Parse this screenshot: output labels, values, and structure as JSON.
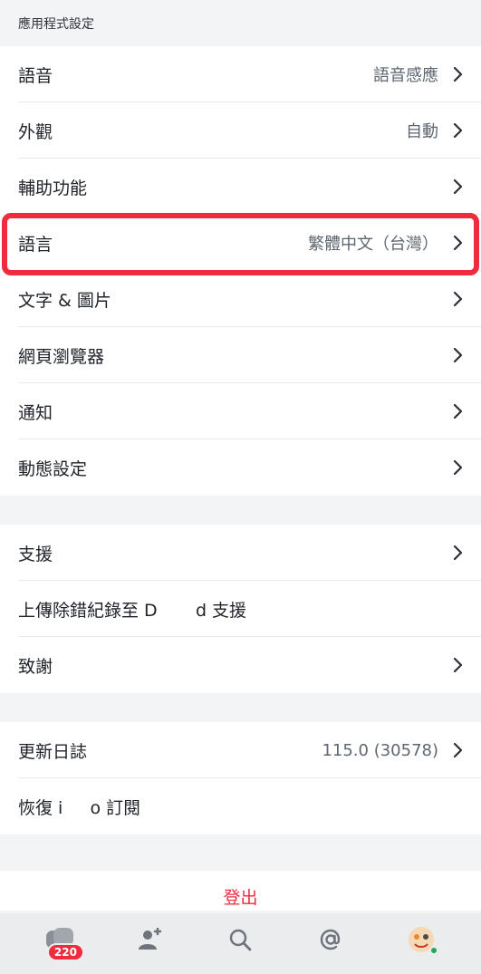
{
  "section_header": "應用程式設定",
  "app_settings": [
    {
      "label": "語音",
      "value": "語音感應"
    },
    {
      "label": "外觀",
      "value": "自動"
    },
    {
      "label": "輔助功能",
      "value": ""
    },
    {
      "label": "語言",
      "value": "繁體中文（台灣）"
    },
    {
      "label": "文字 & 圖片",
      "value": ""
    },
    {
      "label": "網頁瀏覽器",
      "value": ""
    },
    {
      "label": "通知",
      "value": ""
    },
    {
      "label": "動態設定",
      "value": ""
    }
  ],
  "support_items": [
    {
      "label": "支援"
    },
    {
      "label": "上傳除錯紀錄至 D       d 支援"
    },
    {
      "label": "致謝"
    }
  ],
  "info_items": [
    {
      "label": "更新日誌",
      "value": "115.0 (30578)"
    },
    {
      "label": "恢復 i     o 訂閱"
    }
  ],
  "logout_label": "登出",
  "tabbar": {
    "servers_badge": "220",
    "icons": [
      "servers-icon",
      "friends-icon",
      "search-icon",
      "mentions-icon",
      "profile-avatar"
    ]
  },
  "colors": {
    "accent_red": "#ef2c3d",
    "online_green": "#23a55a"
  }
}
